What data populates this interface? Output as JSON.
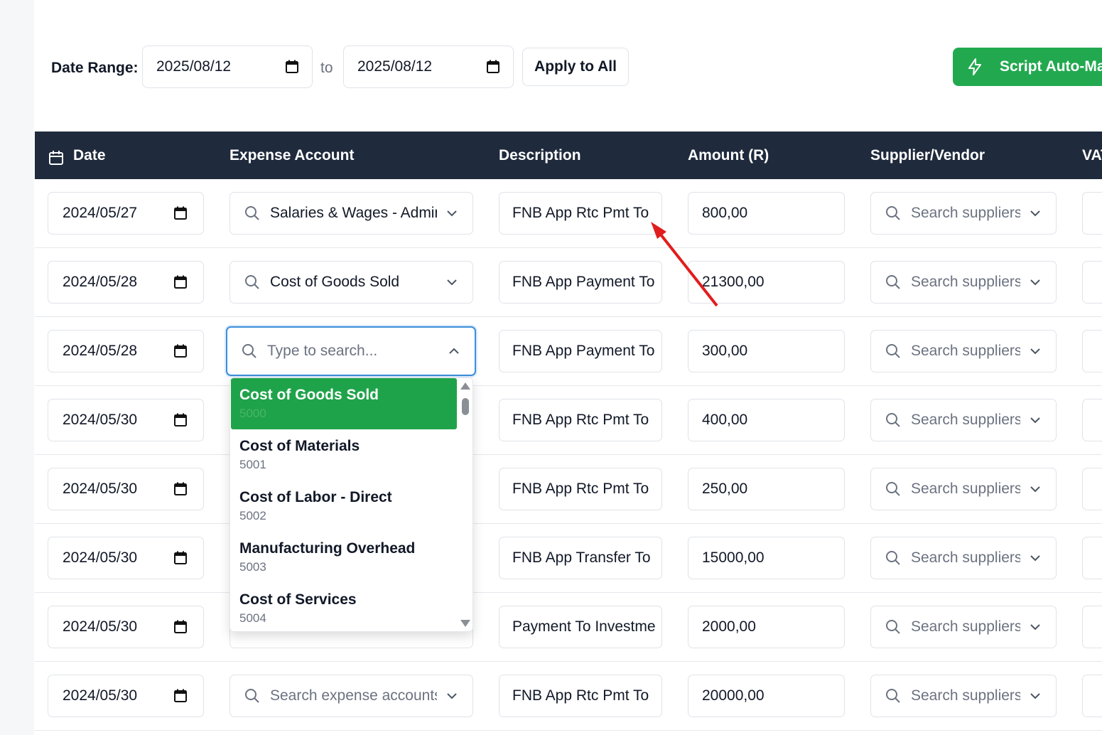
{
  "toolbar": {
    "date_range_label": "Date Range:",
    "from_date": "2025/08/12",
    "to_label": "to",
    "to_date": "2025/08/12",
    "apply_label": "Apply to All",
    "script_label": "Script Auto-Ma"
  },
  "colors": {
    "header_bg": "#1f2a3c",
    "accent_green": "#22a94f",
    "focus_blue": "#3b8fd9",
    "annotation_red": "#e11d1d"
  },
  "table": {
    "headers": {
      "date": "Date",
      "expense_account": "Expense Account",
      "description": "Description",
      "amount": "Amount (R)",
      "supplier": "Supplier/Vendor",
      "vat": "VAT"
    },
    "rows": [
      {
        "date": "2024/05/27",
        "account": "Salaries & Wages - Admin",
        "description": "FNB App Rtc Pmt To",
        "amount": "800,00",
        "supplier": "Search suppliers..."
      },
      {
        "date": "2024/05/28",
        "account": "Cost of Goods Sold",
        "description": "FNB App Payment To",
        "amount": "21300,00",
        "supplier": "Search suppliers..."
      },
      {
        "date": "2024/05/28",
        "account": "Type to search...",
        "description": "FNB App Payment To",
        "amount": "300,00",
        "supplier": "Search suppliers..."
      },
      {
        "date": "2024/05/30",
        "account": "",
        "description": "FNB App Rtc Pmt To",
        "amount": "400,00",
        "supplier": "Search suppliers..."
      },
      {
        "date": "2024/05/30",
        "account": "",
        "description": "FNB App Rtc Pmt To",
        "amount": "250,00",
        "supplier": "Search suppliers..."
      },
      {
        "date": "2024/05/30",
        "account": "",
        "description": "FNB App Transfer To",
        "amount": "15000,00",
        "supplier": "Search suppliers..."
      },
      {
        "date": "2024/05/30",
        "account": "",
        "description": "Payment To Investme",
        "amount": "2000,00",
        "supplier": "Search suppliers..."
      },
      {
        "date": "2024/05/30",
        "account": "Search expense accounts...",
        "description": "FNB App Rtc Pmt To",
        "amount": "20000,00",
        "supplier": "Search suppliers..."
      }
    ]
  },
  "dropdown": {
    "options": [
      {
        "name": "Cost of Goods Sold",
        "code": "5000",
        "selected": true
      },
      {
        "name": "Cost of Materials",
        "code": "5001"
      },
      {
        "name": "Cost of Labor - Direct",
        "code": "5002"
      },
      {
        "name": "Manufacturing Overhead",
        "code": "5003"
      },
      {
        "name": "Cost of Services",
        "code": "5004"
      }
    ]
  }
}
